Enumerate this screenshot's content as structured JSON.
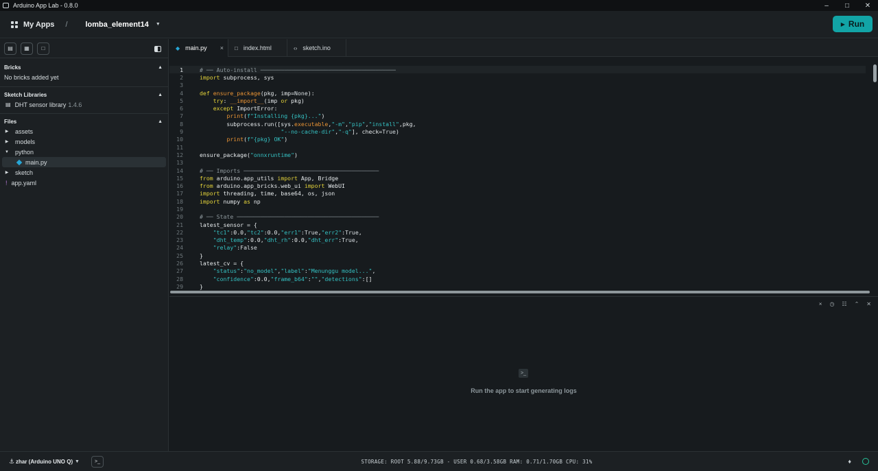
{
  "window": {
    "title": "Arduino App Lab - 0.8.0",
    "controls": [
      "–",
      "□",
      "✕"
    ]
  },
  "header": {
    "my_apps": "My Apps",
    "separator": "/",
    "app_name": "lomba_element14",
    "run_label": "Run"
  },
  "sidebar": {
    "tool_icons": [
      "brick-icon",
      "library-icon",
      "new-file-icon"
    ],
    "bricks": {
      "title": "Bricks",
      "empty": "No bricks added yet"
    },
    "sketch_libraries": {
      "title": "Sketch Libraries",
      "items": [
        {
          "name": "DHT sensor library",
          "version": "1.4.6"
        }
      ]
    },
    "files": {
      "title": "Files",
      "items": [
        {
          "name": "assets",
          "type": "folder"
        },
        {
          "name": "models",
          "type": "folder"
        },
        {
          "name": "python",
          "type": "folder-open"
        },
        {
          "name": "main.py",
          "type": "file-py"
        },
        {
          "name": "sketch",
          "type": "folder"
        },
        {
          "name": "app.yaml",
          "type": "file-yaml"
        }
      ]
    }
  },
  "tabs": [
    {
      "label": "main.py",
      "icon": "python-icon",
      "active": true
    },
    {
      "label": "index.html",
      "icon": "file-icon",
      "active": false
    },
    {
      "label": "sketch.ino",
      "icon": "code-icon",
      "active": false
    }
  ],
  "code": [
    "# ── Auto-install ────────────────────────────────────────",
    "import subprocess, sys",
    "",
    "def ensure_package(pkg, imp=None):",
    "    try: __import__(imp or pkg)",
    "    except ImportError:",
    "        print(f\"Installing {pkg}...\")",
    "        subprocess.run([sys.executable,\"-m\",\"pip\",\"install\",pkg,",
    "                        \"--no-cache-dir\",\"-q\"], check=True)",
    "        print(f\"{pkg} OK\")",
    "",
    "ensure_package(\"onnxruntime\")",
    "",
    "# ── Imports ────────────────────────────────────────",
    "from arduino.app_utils import App, Bridge",
    "from arduino.app_bricks.web_ui import WebUI",
    "import threading, time, base64, os, json",
    "import numpy as np",
    "",
    "# ── State ──────────────────────────────────────────",
    "latest_sensor = {",
    "    \"tc1\":0.0,\"tc2\":0.0,\"err1\":True,\"err2\":True,",
    "    \"dht_temp\":0.0,\"dht_rh\":0.0,\"dht_err\":True,",
    "    \"relay\":False",
    "}",
    "latest_cv = {",
    "    \"status\":\"no_model\",\"label\":\"Menunggu model...\",",
    "    \"confidence\":0.0,\"frame_b64\":\"\",\"detections\":[]",
    "}"
  ],
  "console": {
    "controls": [
      "×",
      "◷",
      "☷",
      "⌃",
      "✕"
    ],
    "message": "Run the app to start generating logs",
    "terminal_glyph": ">_"
  },
  "statusbar": {
    "board": "zhar (Arduino UNO Q)",
    "stats": "STORAGE: ROOT 5.88/9.73GB - USER 0.68/3.58GB  RAM: 0.71/1.70GB  CPU: 31%",
    "terminal_glyph": ">_"
  }
}
